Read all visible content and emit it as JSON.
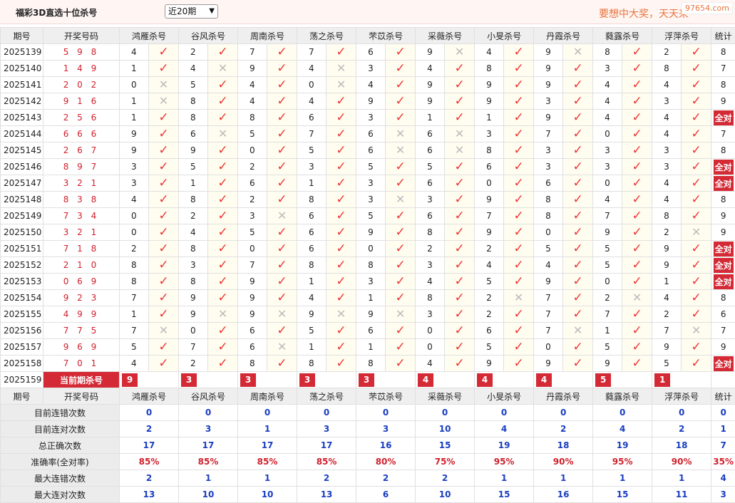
{
  "header": {
    "title": "福彩3D直选十位杀号",
    "period_select": "近20期",
    "marquee": "要想中大奖，天天来",
    "watermark": "97654.com"
  },
  "columns": {
    "period": "期号",
    "draw": "开奖号码",
    "count": "统计",
    "experts": [
      "鸿雁杀号",
      "谷风杀号",
      "周南杀号",
      "荡之杀号",
      "芣苡杀号",
      "采薇杀号",
      "小旻杀号",
      "丹霞杀号",
      "蕤露杀号",
      "浮萍杀号"
    ]
  },
  "rows": [
    {
      "id": "2025139",
      "draw": "5 9 8",
      "kills": [
        "4",
        "2",
        "7",
        "7",
        "6",
        "9",
        "4",
        "9",
        "8",
        "2"
      ],
      "hits": [
        1,
        1,
        1,
        1,
        1,
        0,
        1,
        0,
        1,
        1
      ],
      "count": "8"
    },
    {
      "id": "2025140",
      "draw": "1 4 9",
      "kills": [
        "1",
        "4",
        "9",
        "4",
        "3",
        "4",
        "8",
        "9",
        "3",
        "8"
      ],
      "hits": [
        1,
        0,
        1,
        0,
        1,
        1,
        1,
        1,
        1,
        1
      ],
      "count": "7"
    },
    {
      "id": "2025141",
      "draw": "2 0 2",
      "kills": [
        "0",
        "5",
        "4",
        "0",
        "4",
        "9",
        "9",
        "9",
        "4",
        "4"
      ],
      "hits": [
        0,
        1,
        1,
        0,
        1,
        1,
        1,
        1,
        1,
        1
      ],
      "count": "8"
    },
    {
      "id": "2025142",
      "draw": "9 1 6",
      "kills": [
        "1",
        "8",
        "4",
        "4",
        "9",
        "9",
        "9",
        "3",
        "4",
        "3"
      ],
      "hits": [
        0,
        1,
        1,
        1,
        1,
        1,
        1,
        1,
        1,
        1
      ],
      "count": "9"
    },
    {
      "id": "2025143",
      "draw": "2 5 6",
      "kills": [
        "1",
        "8",
        "8",
        "6",
        "3",
        "1",
        "1",
        "9",
        "4",
        "4"
      ],
      "hits": [
        1,
        1,
        1,
        1,
        1,
        1,
        1,
        1,
        1,
        1
      ],
      "count": "全对"
    },
    {
      "id": "2025144",
      "draw": "6 6 6",
      "kills": [
        "9",
        "6",
        "5",
        "7",
        "6",
        "6",
        "3",
        "7",
        "0",
        "4"
      ],
      "hits": [
        1,
        0,
        1,
        1,
        0,
        0,
        1,
        1,
        1,
        1
      ],
      "count": "7"
    },
    {
      "id": "2025145",
      "draw": "2 6 7",
      "kills": [
        "9",
        "9",
        "0",
        "5",
        "6",
        "6",
        "8",
        "3",
        "3",
        "3"
      ],
      "hits": [
        1,
        1,
        1,
        1,
        0,
        0,
        1,
        1,
        1,
        1
      ],
      "count": "8"
    },
    {
      "id": "2025146",
      "draw": "8 9 7",
      "kills": [
        "3",
        "5",
        "2",
        "3",
        "5",
        "5",
        "6",
        "3",
        "3",
        "3"
      ],
      "hits": [
        1,
        1,
        1,
        1,
        1,
        1,
        1,
        1,
        1,
        1
      ],
      "count": "全对"
    },
    {
      "id": "2025147",
      "draw": "3 2 1",
      "kills": [
        "3",
        "1",
        "6",
        "1",
        "3",
        "6",
        "0",
        "6",
        "0",
        "4"
      ],
      "hits": [
        1,
        1,
        1,
        1,
        1,
        1,
        1,
        1,
        1,
        1
      ],
      "count": "全对"
    },
    {
      "id": "2025148",
      "draw": "8 3 8",
      "kills": [
        "4",
        "8",
        "2",
        "8",
        "3",
        "3",
        "9",
        "8",
        "4",
        "4"
      ],
      "hits": [
        1,
        1,
        1,
        1,
        0,
        1,
        1,
        1,
        1,
        1
      ],
      "count": "8"
    },
    {
      "id": "2025149",
      "draw": "7 3 4",
      "kills": [
        "0",
        "2",
        "3",
        "6",
        "5",
        "6",
        "7",
        "8",
        "7",
        "8"
      ],
      "hits": [
        1,
        1,
        0,
        1,
        1,
        1,
        1,
        1,
        1,
        1
      ],
      "count": "9"
    },
    {
      "id": "2025150",
      "draw": "3 2 1",
      "kills": [
        "0",
        "4",
        "5",
        "6",
        "9",
        "8",
        "9",
        "0",
        "9",
        "2"
      ],
      "hits": [
        1,
        1,
        1,
        1,
        1,
        1,
        1,
        1,
        1,
        0
      ],
      "count": "9"
    },
    {
      "id": "2025151",
      "draw": "7 1 8",
      "kills": [
        "2",
        "8",
        "0",
        "6",
        "0",
        "2",
        "2",
        "5",
        "5",
        "9"
      ],
      "hits": [
        1,
        1,
        1,
        1,
        1,
        1,
        1,
        1,
        1,
        1
      ],
      "count": "全对"
    },
    {
      "id": "2025152",
      "draw": "2 1 0",
      "kills": [
        "8",
        "3",
        "7",
        "8",
        "8",
        "3",
        "4",
        "4",
        "5",
        "9"
      ],
      "hits": [
        1,
        1,
        1,
        1,
        1,
        1,
        1,
        1,
        1,
        1
      ],
      "count": "全对"
    },
    {
      "id": "2025153",
      "draw": "0 6 9",
      "kills": [
        "8",
        "8",
        "9",
        "1",
        "3",
        "4",
        "5",
        "9",
        "0",
        "1"
      ],
      "hits": [
        1,
        1,
        1,
        1,
        1,
        1,
        1,
        1,
        1,
        1
      ],
      "count": "全对"
    },
    {
      "id": "2025154",
      "draw": "9 2 3",
      "kills": [
        "7",
        "9",
        "9",
        "4",
        "1",
        "8",
        "2",
        "7",
        "2",
        "4"
      ],
      "hits": [
        1,
        1,
        1,
        1,
        1,
        1,
        0,
        1,
        0,
        1
      ],
      "count": "8"
    },
    {
      "id": "2025155",
      "draw": "4 9 9",
      "kills": [
        "1",
        "9",
        "9",
        "9",
        "9",
        "3",
        "2",
        "7",
        "7",
        "2"
      ],
      "hits": [
        1,
        0,
        0,
        0,
        0,
        1,
        1,
        1,
        1,
        1
      ],
      "count": "6"
    },
    {
      "id": "2025156",
      "draw": "7 7 5",
      "kills": [
        "7",
        "0",
        "6",
        "5",
        "6",
        "0",
        "6",
        "7",
        "1",
        "7"
      ],
      "hits": [
        0,
        1,
        1,
        1,
        1,
        1,
        1,
        0,
        1,
        0
      ],
      "count": "7"
    },
    {
      "id": "2025157",
      "draw": "9 6 9",
      "kills": [
        "5",
        "7",
        "6",
        "1",
        "1",
        "0",
        "5",
        "0",
        "5",
        "9"
      ],
      "hits": [
        1,
        1,
        0,
        1,
        1,
        1,
        1,
        1,
        1,
        1
      ],
      "count": "9"
    },
    {
      "id": "2025158",
      "draw": "7 0 1",
      "kills": [
        "4",
        "2",
        "8",
        "8",
        "8",
        "4",
        "9",
        "9",
        "9",
        "5"
      ],
      "hits": [
        1,
        1,
        1,
        1,
        1,
        1,
        1,
        1,
        1,
        1
      ],
      "count": "全对"
    }
  ],
  "current": {
    "id": "2025159",
    "label": "当前期杀号",
    "kills": [
      "9",
      "3",
      "3",
      "3",
      "3",
      "4",
      "4",
      "4",
      "5",
      "1"
    ]
  },
  "stats": {
    "labels": [
      "目前连错次数",
      "目前连对次数",
      "总正确次数",
      "准确率(全对率)",
      "最大连错次数",
      "最大连对次数"
    ],
    "values": [
      [
        "0",
        "0",
        "0",
        "0",
        "0",
        "0",
        "0",
        "0",
        "0",
        "0",
        "0"
      ],
      [
        "2",
        "3",
        "1",
        "3",
        "3",
        "10",
        "4",
        "2",
        "4",
        "2",
        "1"
      ],
      [
        "17",
        "17",
        "17",
        "17",
        "16",
        "15",
        "19",
        "18",
        "19",
        "18",
        "7"
      ],
      [
        "85%",
        "85%",
        "85%",
        "85%",
        "80%",
        "75%",
        "95%",
        "90%",
        "95%",
        "90%",
        "35%"
      ],
      [
        "2",
        "1",
        "1",
        "2",
        "2",
        "2",
        "1",
        "1",
        "1",
        "1",
        "4"
      ],
      [
        "13",
        "10",
        "10",
        "13",
        "6",
        "10",
        "15",
        "16",
        "15",
        "11",
        "3"
      ]
    ]
  },
  "colors": {
    "hit": "#e33333",
    "miss": "#bbbbbb",
    "accent": "#d42a36",
    "stat_value": "#1a3ec0"
  }
}
